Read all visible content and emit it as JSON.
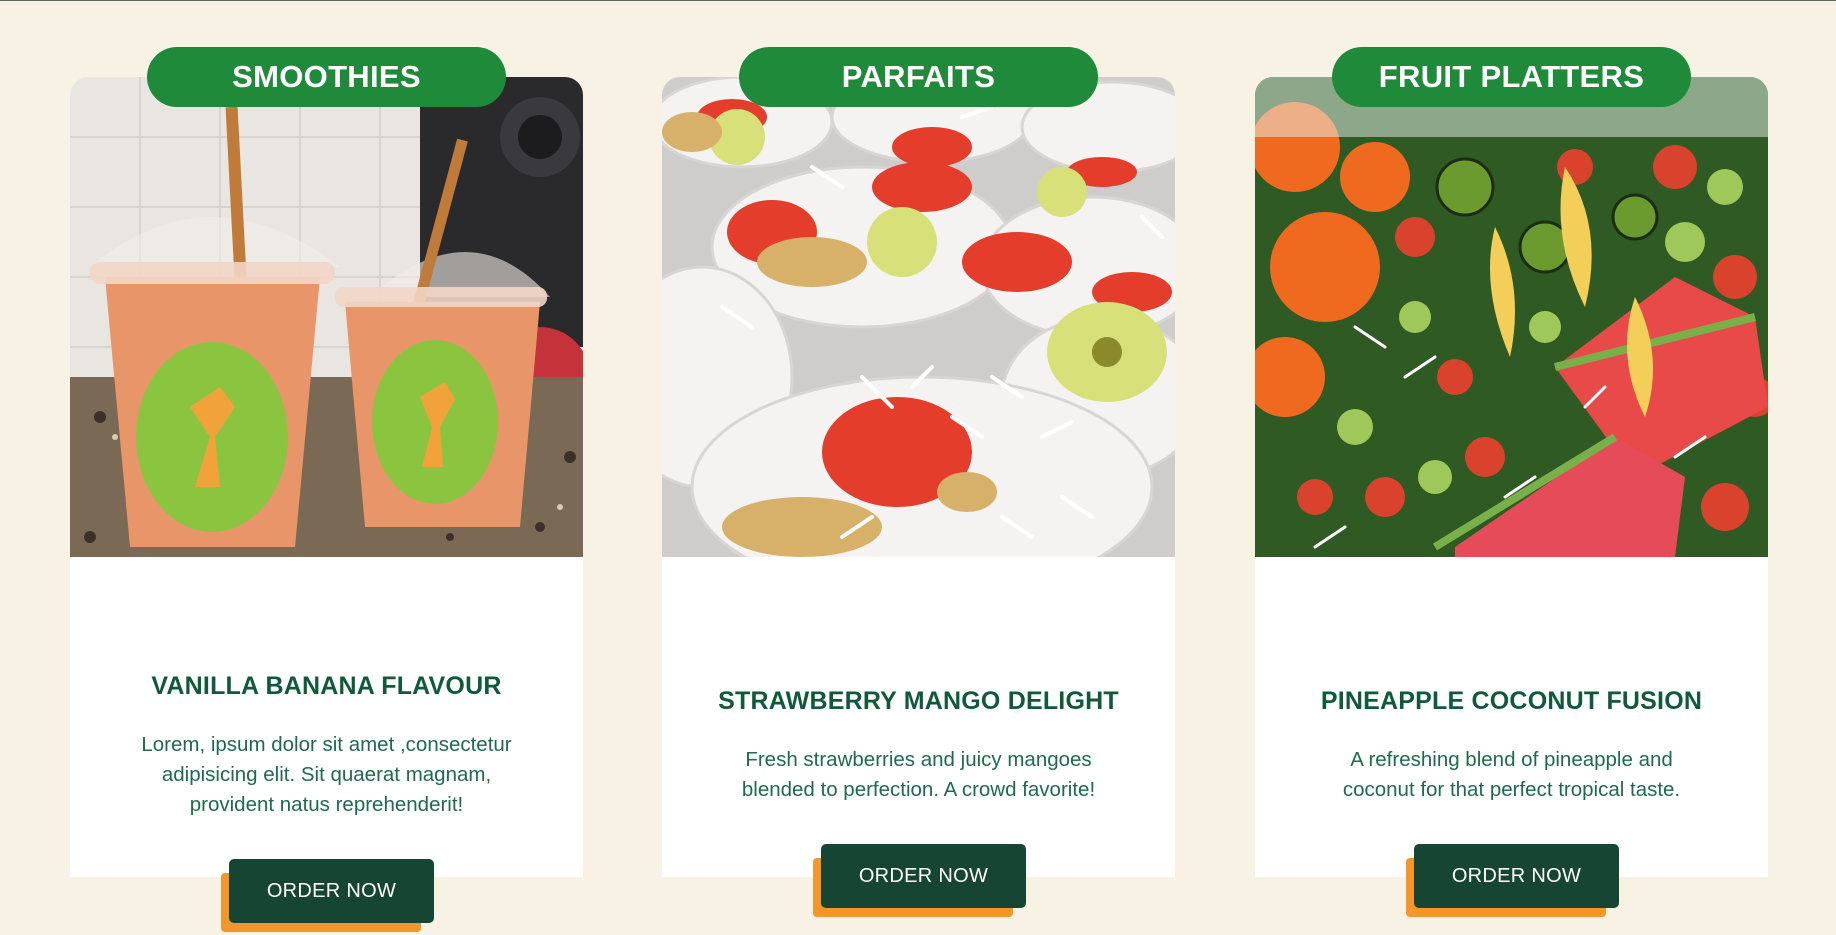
{
  "cards": [
    {
      "category": "SMOOTHIES",
      "title": "VANILLA BANANA FLAVOUR",
      "description": "Lorem, ipsum dolor sit amet ,consectetur adipisicing elit. Sit quaerat magnam, provident natus reprehenderit!",
      "button_label": "ORDER NOW",
      "image_label": "smoothie cups photo"
    },
    {
      "category": "PARFAITS",
      "title": "STRAWBERRY MANGO DELIGHT",
      "description": "Fresh strawberries and juicy mangoes blended to perfection. A crowd favorite!",
      "button_label": "ORDER NOW",
      "image_label": "parfait cups photo"
    },
    {
      "category": "FRUIT PLATTERS",
      "title": "PINEAPPLE COCONUT FUSION",
      "description": "A refreshing blend of pineapple and coconut for that perfect tropical taste.",
      "button_label": "ORDER NOW",
      "image_label": "fruit platter photo"
    }
  ],
  "colors": {
    "page_bg": "#f7f2e3",
    "badge_green": "#1f8a3a",
    "title_green": "#0f5a3a",
    "button_dark": "#164533",
    "button_shadow_orange": "#f5962a"
  }
}
